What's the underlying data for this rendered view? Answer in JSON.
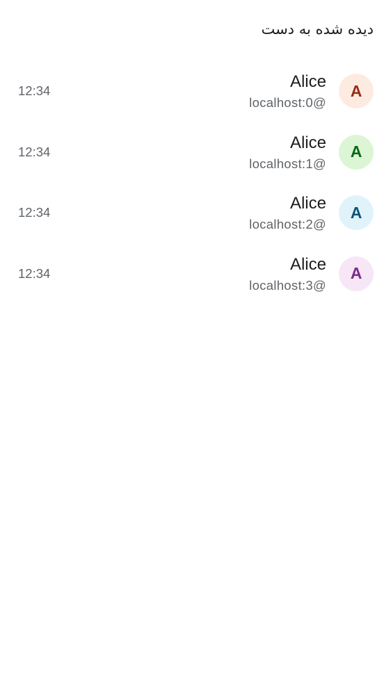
{
  "heading": "دیده شده به دست",
  "receipts": [
    {
      "avatar_letter": "A",
      "avatar_bg": "#fdebe2",
      "avatar_fg": "#9b2b12",
      "name": "Alice",
      "address": "localhost:0@",
      "time": "12:34"
    },
    {
      "avatar_letter": "A",
      "avatar_bg": "#dcf5d5",
      "avatar_fg": "#0b6a14",
      "name": "Alice",
      "address": "localhost:1@",
      "time": "12:34"
    },
    {
      "avatar_letter": "A",
      "avatar_bg": "#e1f3fa",
      "avatar_fg": "#0e5578",
      "name": "Alice",
      "address": "localhost:2@",
      "time": "12:34"
    },
    {
      "avatar_letter": "A",
      "avatar_bg": "#f7e6f6",
      "avatar_fg": "#7a2a8c",
      "name": "Alice",
      "address": "localhost:3@",
      "time": "12:34"
    }
  ]
}
